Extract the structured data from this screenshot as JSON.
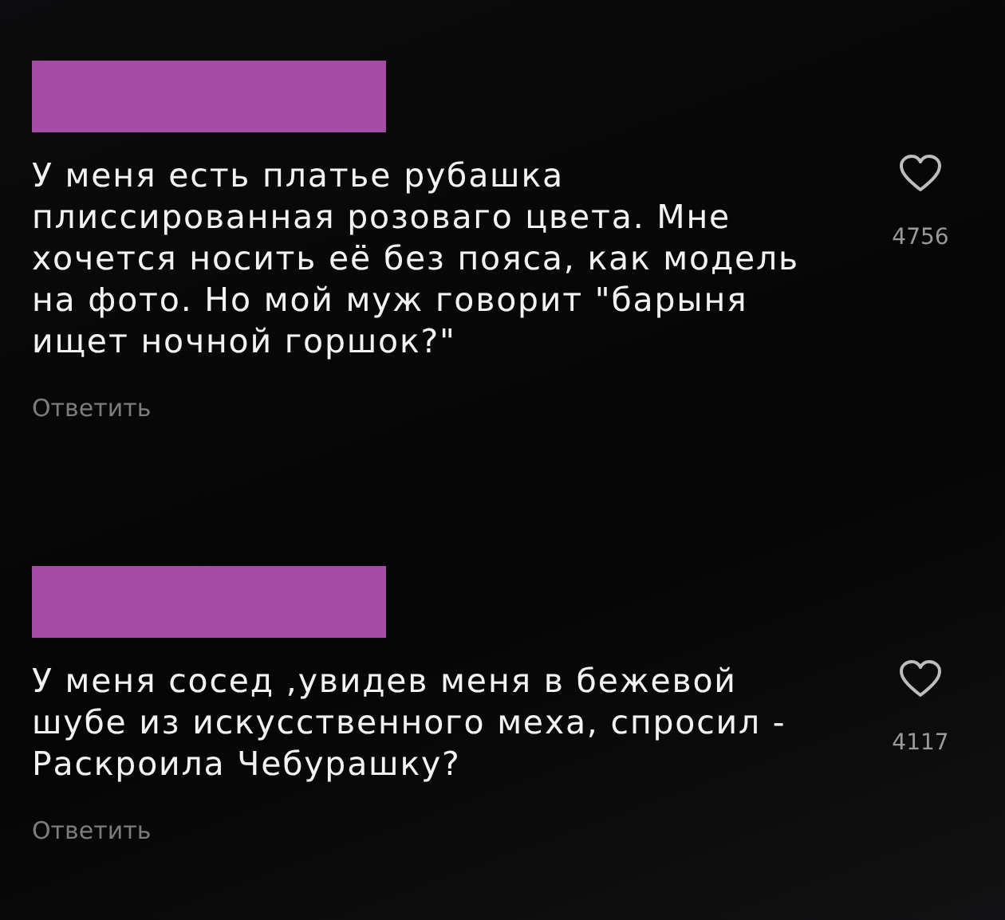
{
  "comments": [
    {
      "author_redacted": true,
      "text": "У меня есть платье рубашка\nплиссированная розоваго цвета. Мне\nхочется носить её без пояса, как модель\nна фото. Но мой муж говорит \"барыня\nищет ночной горшок?\"",
      "reply_label": "Ответить",
      "likes": "4756",
      "liked": false
    },
    {
      "author_redacted": true,
      "text": "У меня сосед ,увидев меня в бежевой\nшубе из искусственного меха, спросил -\nРаскроила Чебурашку?",
      "reply_label": "Ответить",
      "likes": "4117",
      "liked": false
    }
  ]
}
